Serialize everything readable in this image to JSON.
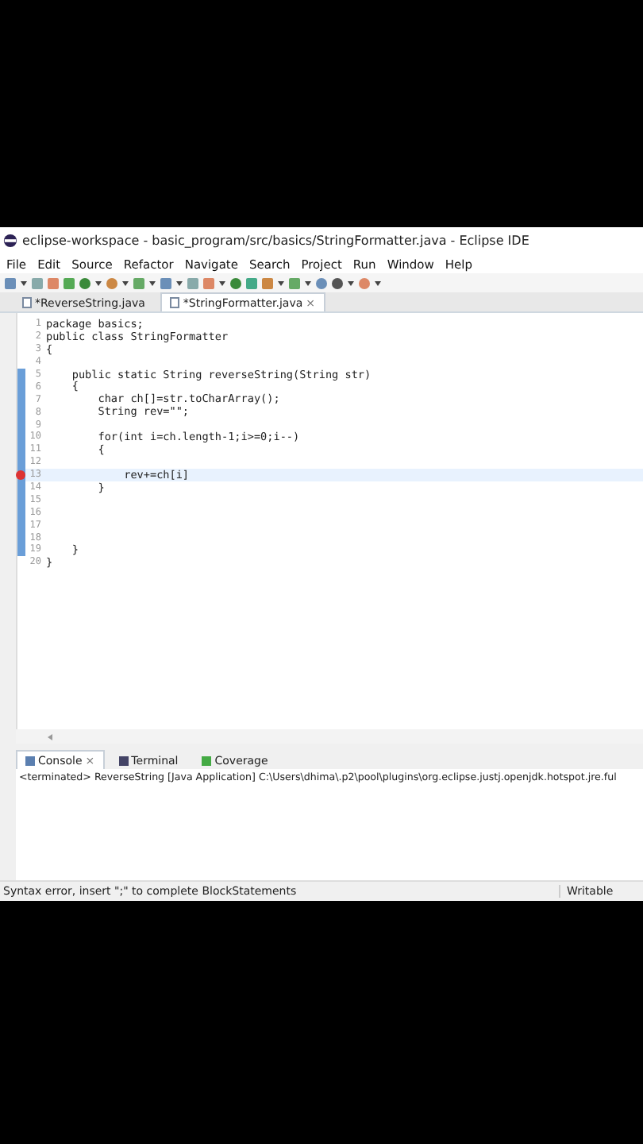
{
  "window": {
    "title": "eclipse-workspace - basic_program/src/basics/StringFormatter.java - Eclipse IDE"
  },
  "menu": [
    "File",
    "Edit",
    "Source",
    "Refactor",
    "Navigate",
    "Search",
    "Project",
    "Run",
    "Window",
    "Help"
  ],
  "editor_tabs": [
    {
      "label": "*ReverseString.java",
      "selected": false,
      "closable": false
    },
    {
      "label": "*StringFormatter.java",
      "selected": true,
      "closable": true
    }
  ],
  "close_glyph": "×",
  "code": [
    {
      "number": "1",
      "text": "package basics;",
      "changed": false,
      "error": false
    },
    {
      "number": "2",
      "text": "public class StringFormatter",
      "changed": false,
      "error": false
    },
    {
      "number": "3",
      "text": "{",
      "changed": false,
      "error": false
    },
    {
      "number": "4",
      "changed": false,
      "error": false
    },
    {
      "number": "5",
      "text": "    public static String reverseString(String str)",
      "changed": true,
      "error": false
    },
    {
      "number": "6",
      "text": "    {",
      "changed": true,
      "error": false
    },
    {
      "number": "7",
      "text": "        char ch[]=str.toCharArray();",
      "changed": true,
      "error": false
    },
    {
      "number": "8",
      "text": "        String rev=\"\";",
      "changed": true,
      "error": false
    },
    {
      "number": "9",
      "changed": true,
      "error": false
    },
    {
      "number": "10",
      "text": "        for(int i=ch.length-1;i>=0;i--)",
      "changed": true,
      "error": false
    },
    {
      "number": "11",
      "text": "        {",
      "changed": true,
      "error": false
    },
    {
      "number": "12",
      "changed": true,
      "error": false
    },
    {
      "number": "13",
      "text": "            rev+=ch[i]",
      "changed": true,
      "error": true
    },
    {
      "number": "14",
      "text": "        }",
      "changed": true,
      "error": false
    },
    {
      "number": "15",
      "changed": true,
      "error": false
    },
    {
      "number": "16",
      "changed": true,
      "error": false
    },
    {
      "number": "17",
      "changed": true,
      "error": false
    },
    {
      "number": "18",
      "changed": true,
      "error": false
    },
    {
      "number": "19",
      "text": "    }",
      "changed": true,
      "error": false
    },
    {
      "number": "20",
      "text": "}",
      "changed": false,
      "error": false
    }
  ],
  "console_tabs": [
    {
      "label": "Console",
      "selected": true,
      "closable": true
    },
    {
      "label": "Terminal",
      "selected": false,
      "closable": false
    },
    {
      "label": "Coverage",
      "selected": false,
      "closable": false
    }
  ],
  "console_line": "<terminated> ReverseString [Java Application] C:\\Users\\dhima\\.p2\\pool\\plugins\\org.eclipse.justj.openjdk.hotspot.jre.ful",
  "status_bar": {
    "message": "Syntax error, insert \";\" to complete BlockStatements",
    "mode": "Writable"
  }
}
